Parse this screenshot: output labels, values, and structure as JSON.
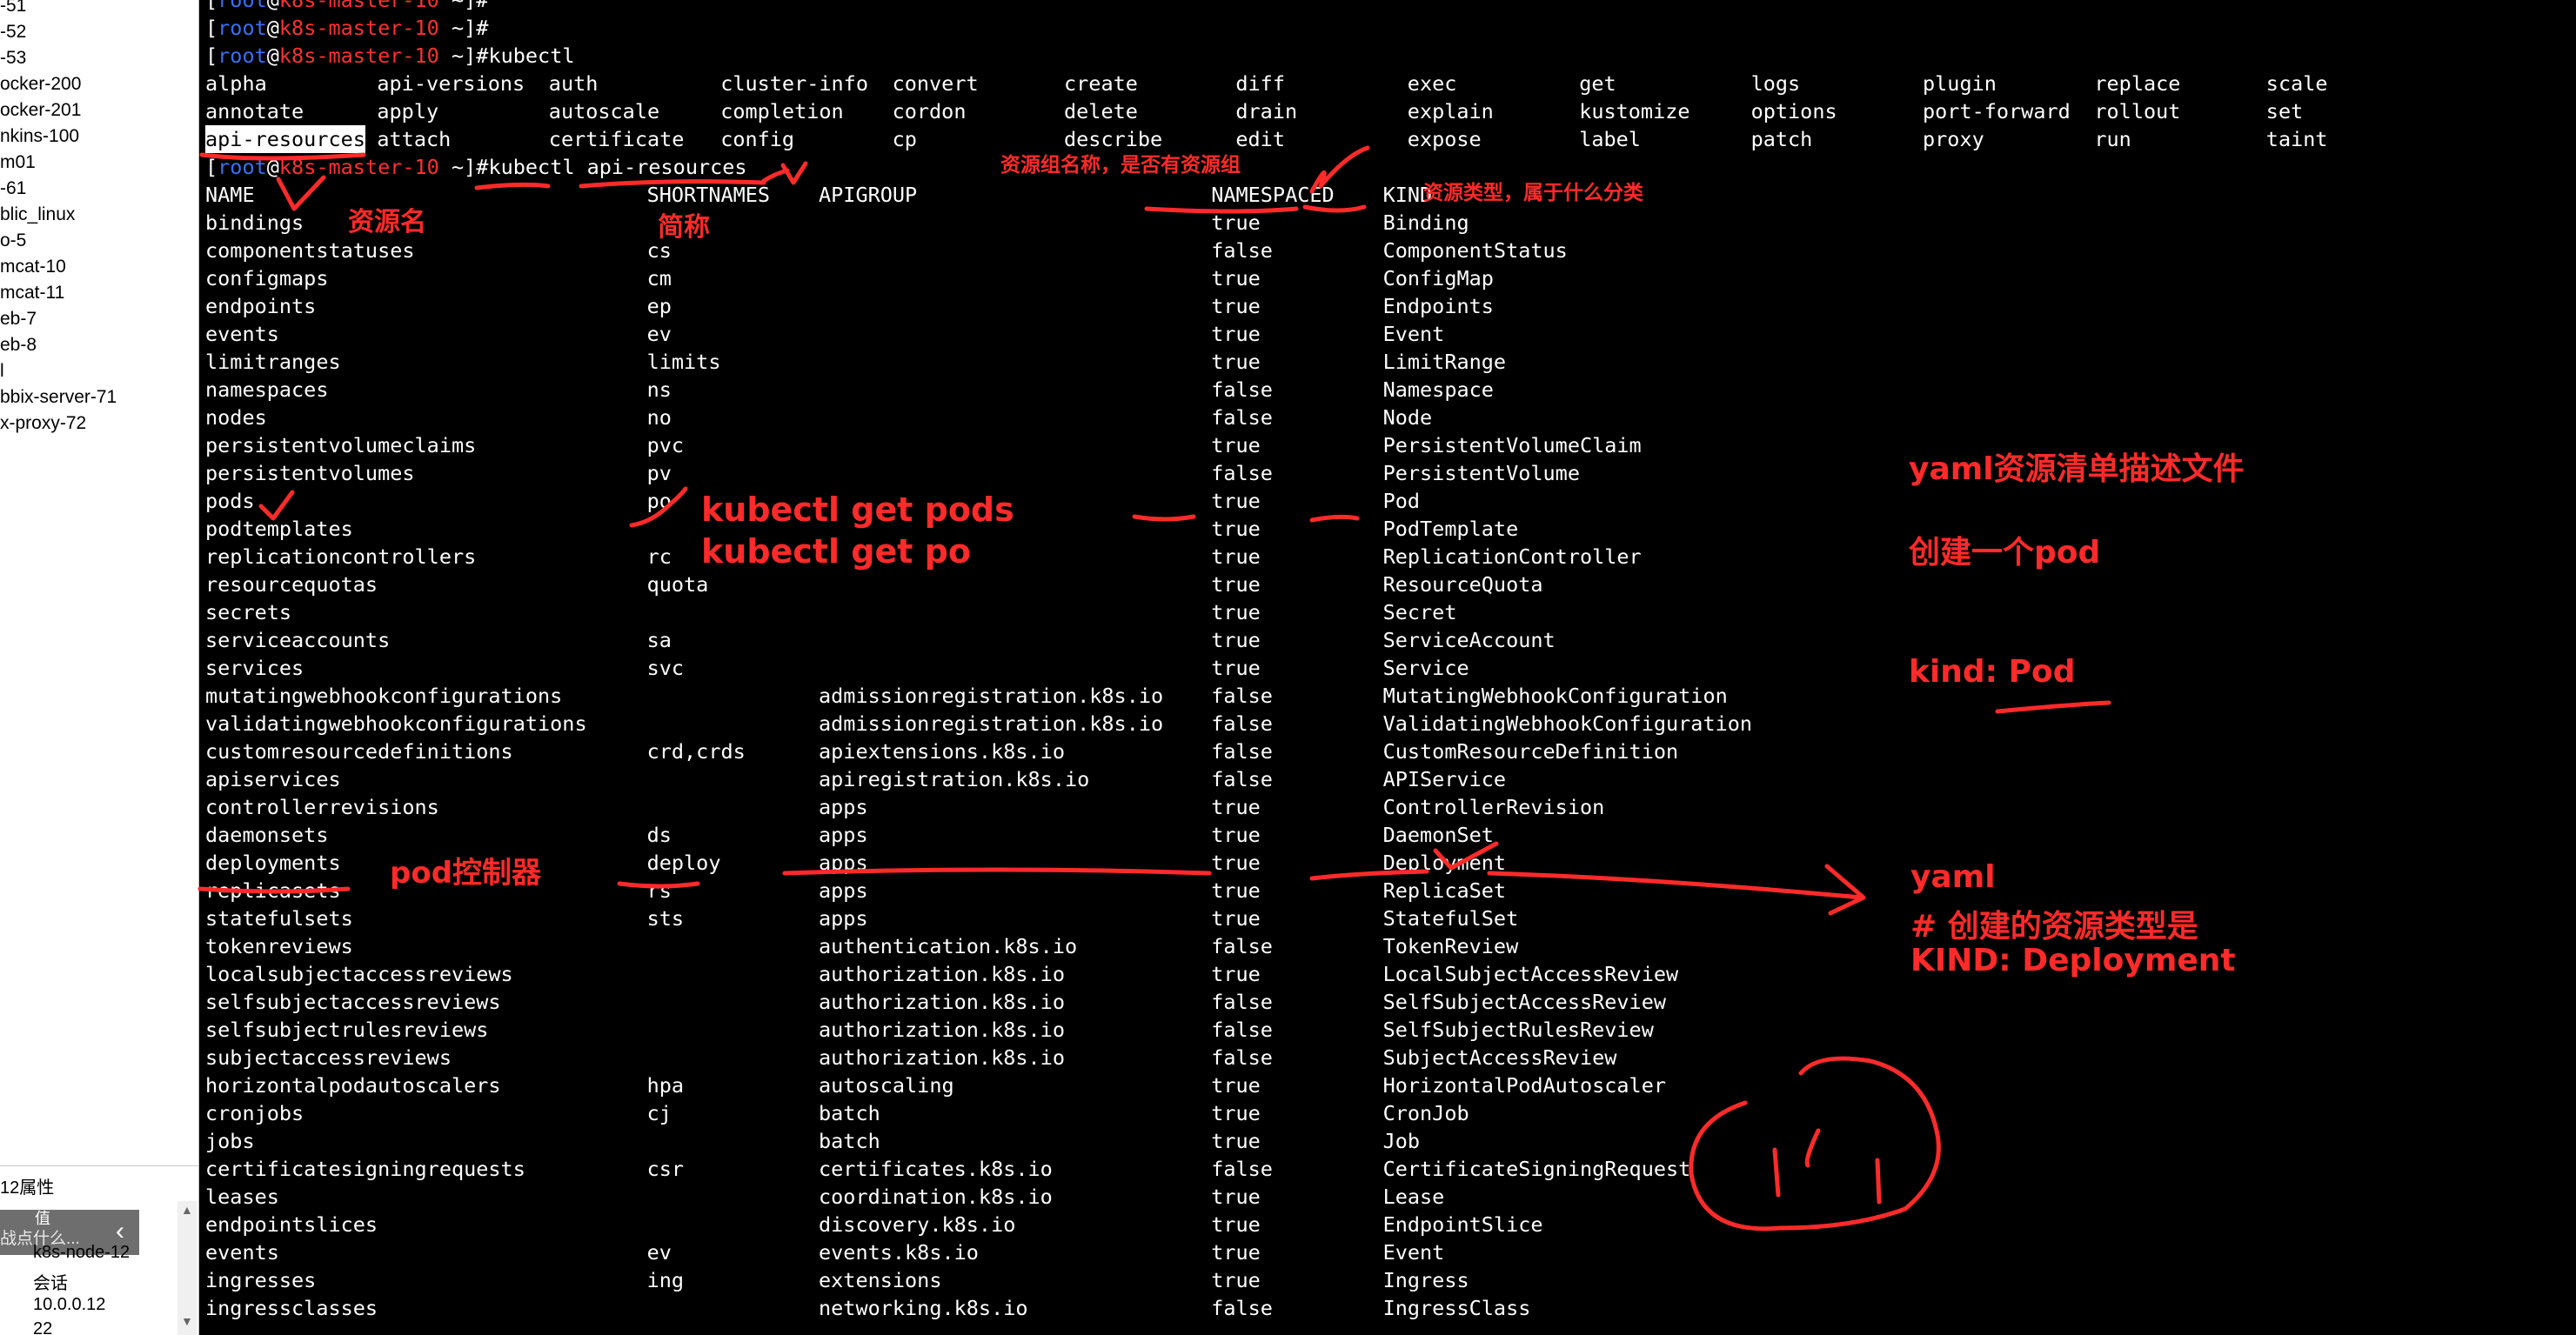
{
  "sidebar": {
    "sessions": [
      "-51",
      "-52",
      "-53",
      "ocker-200",
      "ocker-201",
      "nkins-100",
      "m01",
      "-61",
      "blic_linux",
      "o-5",
      "mcat-10",
      "mcat-11",
      "eb-7",
      "eb-8",
      "l",
      "bbix-server-71",
      "x-proxy-72"
    ],
    "properties_title": "12属性",
    "search_placeholder": "战点什么...",
    "collapse_glyph": "‹",
    "column_value": "值",
    "values": [
      "k8s-node-12",
      "会话",
      "10.0.0.12",
      "22"
    ]
  },
  "terminal": {
    "prompt": {
      "open": "[",
      "user": "root",
      "at": "@",
      "host": "k8s-master-10",
      "path": " ~",
      "close": "]",
      "hash": "#"
    },
    "cmd_kubectl": "kubectl",
    "cmd_api_resources": "kubectl api-resources",
    "subcommands": [
      [
        "alpha",
        "api-versions",
        "auth",
        "cluster-info",
        "convert",
        "create",
        "diff",
        "exec",
        "get",
        "logs",
        "plugin",
        "replace",
        "scale"
      ],
      [
        "annotate",
        "apply",
        "autoscale",
        "completion",
        "cordon",
        "delete",
        "drain",
        "explain",
        "kustomize",
        "options",
        "port-forward",
        "rollout",
        "set"
      ],
      [
        "api-resources",
        "attach",
        "certificate",
        "config",
        "cp",
        "describe",
        "edit",
        "expose",
        "label",
        "patch",
        "proxy",
        "run",
        "taint"
      ]
    ],
    "headers": {
      "name": "NAME",
      "shortnames": "SHORTNAMES",
      "apigroup": "APIGROUP",
      "namespaced": "NAMESPACED",
      "kind": "KIND"
    },
    "resources": [
      [
        "bindings",
        "",
        "",
        "true",
        "Binding"
      ],
      [
        "componentstatuses",
        "cs",
        "",
        "false",
        "ComponentStatus"
      ],
      [
        "configmaps",
        "cm",
        "",
        "true",
        "ConfigMap"
      ],
      [
        "endpoints",
        "ep",
        "",
        "true",
        "Endpoints"
      ],
      [
        "events",
        "ev",
        "",
        "true",
        "Event"
      ],
      [
        "limitranges",
        "limits",
        "",
        "true",
        "LimitRange"
      ],
      [
        "namespaces",
        "ns",
        "",
        "false",
        "Namespace"
      ],
      [
        "nodes",
        "no",
        "",
        "false",
        "Node"
      ],
      [
        "persistentvolumeclaims",
        "pvc",
        "",
        "true",
        "PersistentVolumeClaim"
      ],
      [
        "persistentvolumes",
        "pv",
        "",
        "false",
        "PersistentVolume"
      ],
      [
        "pods",
        "po",
        "",
        "true",
        "Pod"
      ],
      [
        "podtemplates",
        "",
        "",
        "true",
        "PodTemplate"
      ],
      [
        "replicationcontrollers",
        "rc",
        "",
        "true",
        "ReplicationController"
      ],
      [
        "resourcequotas",
        "quota",
        "",
        "true",
        "ResourceQuota"
      ],
      [
        "secrets",
        "",
        "",
        "true",
        "Secret"
      ],
      [
        "serviceaccounts",
        "sa",
        "",
        "true",
        "ServiceAccount"
      ],
      [
        "services",
        "svc",
        "",
        "true",
        "Service"
      ],
      [
        "mutatingwebhookconfigurations",
        "",
        "admissionregistration.k8s.io",
        "false",
        "MutatingWebhookConfiguration"
      ],
      [
        "validatingwebhookconfigurations",
        "",
        "admissionregistration.k8s.io",
        "false",
        "ValidatingWebhookConfiguration"
      ],
      [
        "customresourcedefinitions",
        "crd,crds",
        "apiextensions.k8s.io",
        "false",
        "CustomResourceDefinition"
      ],
      [
        "apiservices",
        "",
        "apiregistration.k8s.io",
        "false",
        "APIService"
      ],
      [
        "controllerrevisions",
        "",
        "apps",
        "true",
        "ControllerRevision"
      ],
      [
        "daemonsets",
        "ds",
        "apps",
        "true",
        "DaemonSet"
      ],
      [
        "deployments",
        "deploy",
        "apps",
        "true",
        "Deployment"
      ],
      [
        "replicasets",
        "rs",
        "apps",
        "true",
        "ReplicaSet"
      ],
      [
        "statefulsets",
        "sts",
        "apps",
        "true",
        "StatefulSet"
      ],
      [
        "tokenreviews",
        "",
        "authentication.k8s.io",
        "false",
        "TokenReview"
      ],
      [
        "localsubjectaccessreviews",
        "",
        "authorization.k8s.io",
        "true",
        "LocalSubjectAccessReview"
      ],
      [
        "selfsubjectaccessreviews",
        "",
        "authorization.k8s.io",
        "false",
        "SelfSubjectAccessReview"
      ],
      [
        "selfsubjectrulesreviews",
        "",
        "authorization.k8s.io",
        "false",
        "SelfSubjectRulesReview"
      ],
      [
        "subjectaccessreviews",
        "",
        "authorization.k8s.io",
        "false",
        "SubjectAccessReview"
      ],
      [
        "horizontalpodautoscalers",
        "hpa",
        "autoscaling",
        "true",
        "HorizontalPodAutoscaler"
      ],
      [
        "cronjobs",
        "cj",
        "batch",
        "true",
        "CronJob"
      ],
      [
        "jobs",
        "",
        "batch",
        "true",
        "Job"
      ],
      [
        "certificatesigningrequests",
        "csr",
        "certificates.k8s.io",
        "false",
        "CertificateSigningRequest"
      ],
      [
        "leases",
        "",
        "coordination.k8s.io",
        "true",
        "Lease"
      ],
      [
        "endpointslices",
        "",
        "discovery.k8s.io",
        "true",
        "EndpointSlice"
      ],
      [
        "events",
        "ev",
        "events.k8s.io",
        "true",
        "Event"
      ],
      [
        "ingresses",
        "ing",
        "extensions",
        "true",
        "Ingress"
      ],
      [
        "ingressclasses",
        "",
        "networking.k8s.io",
        "false",
        "IngressClass"
      ]
    ]
  },
  "annotations": {
    "apigroup_note": "资源组名称，是否有资源组",
    "kind_note": "资源类型，属于什么分类",
    "name_note": "资源名",
    "short_note": "简称",
    "kubectl_get_pods": "kubectl get pods",
    "kubectl_get_po": "kubectl get po",
    "yaml_file": "yaml资源清单描述文件",
    "create_pod": "创建一个pod",
    "kind_pod": "kind: Pod",
    "pod_controller": "pod控制器",
    "yaml": "yaml",
    "create_type": "# 创建的资源类型是",
    "kind_deployment": "KIND:  Deployment"
  },
  "colors": {
    "annotation": "#ff2a2a",
    "prompt_user": "#3a6ff5",
    "prompt_host": "#ff3030",
    "terminal_bg": "#000000"
  }
}
